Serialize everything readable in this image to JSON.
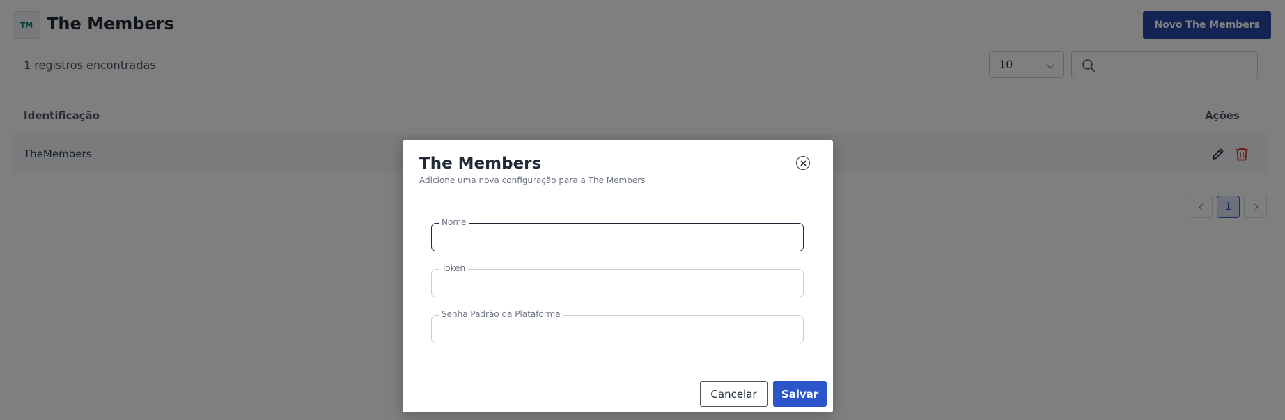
{
  "header": {
    "logo_text": "TM",
    "title": "The Members",
    "new_button_label": "Novo The Members"
  },
  "toolbar": {
    "record_count": "1 registros encontradas",
    "page_size": "10",
    "search": {
      "value": "",
      "placeholder": ""
    }
  },
  "table": {
    "columns": [
      "Identificação",
      "Ações"
    ],
    "rows": [
      {
        "identificacao": "TheMembers"
      }
    ]
  },
  "pagination": {
    "current_page": "1"
  },
  "modal": {
    "title": "The Members",
    "subtitle": "Adicione uma nova configuração para a The Members",
    "fields": [
      {
        "label": "Nome",
        "value": ""
      },
      {
        "label": "Token",
        "value": ""
      },
      {
        "label": "Senha Padrão da Plataforma",
        "value": ""
      }
    ],
    "cancel_label": "Cancelar",
    "save_label": "Salvar"
  },
  "colors": {
    "primary": "#2647a8",
    "save": "#2c55c9",
    "delete": "#dc2626",
    "overlay": "rgba(0,0,0,0.5)"
  }
}
